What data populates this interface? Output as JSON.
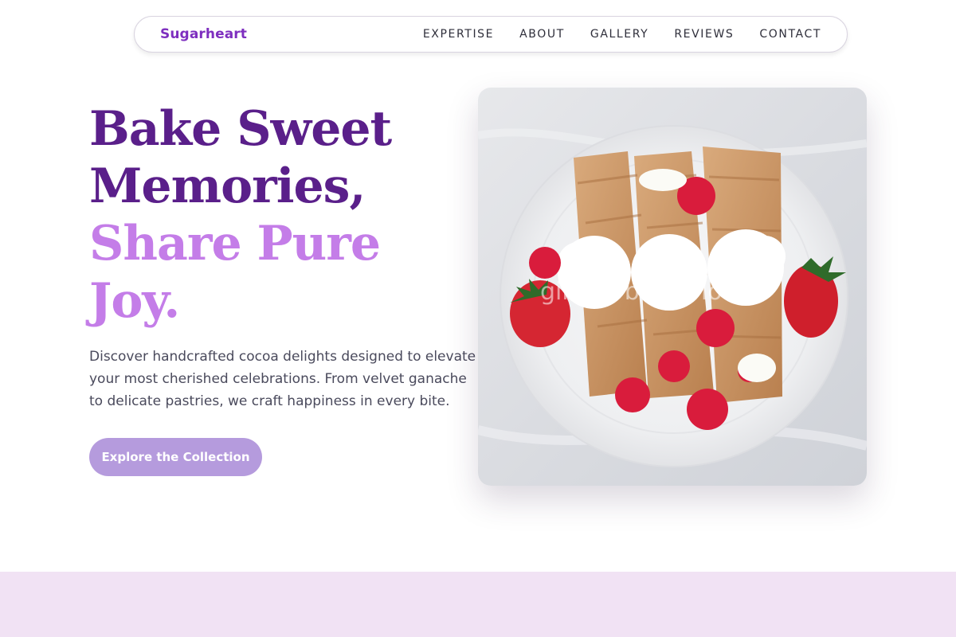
{
  "nav": {
    "brand": "Sugarheart",
    "links": [
      "EXPERTISE",
      "ABOUT",
      "GALLERY",
      "REVIEWS",
      "CONTACT"
    ]
  },
  "hero": {
    "headline": {
      "line1": "Bake Sweet",
      "line2": "Memories,",
      "line3": "Share Pure",
      "line4": "Joy."
    },
    "description": "Discover handcrafted cocoa delights designed to elevate your most cherished celebrations. From velvet ganache to delicate pastries, we craft happiness in every bite.",
    "cta_label": "Explore the Collection",
    "image": {
      "subject": "crepes-with-strawberries-raspberries-and-whipped-cream",
      "watermark": "ginger bread love"
    }
  },
  "colors": {
    "brand": "#7e2fbf",
    "headline_dark": "#5a1f8a",
    "headline_light": "#c47de8",
    "cta": "#b59bdd",
    "band": "#f1e2f4"
  }
}
